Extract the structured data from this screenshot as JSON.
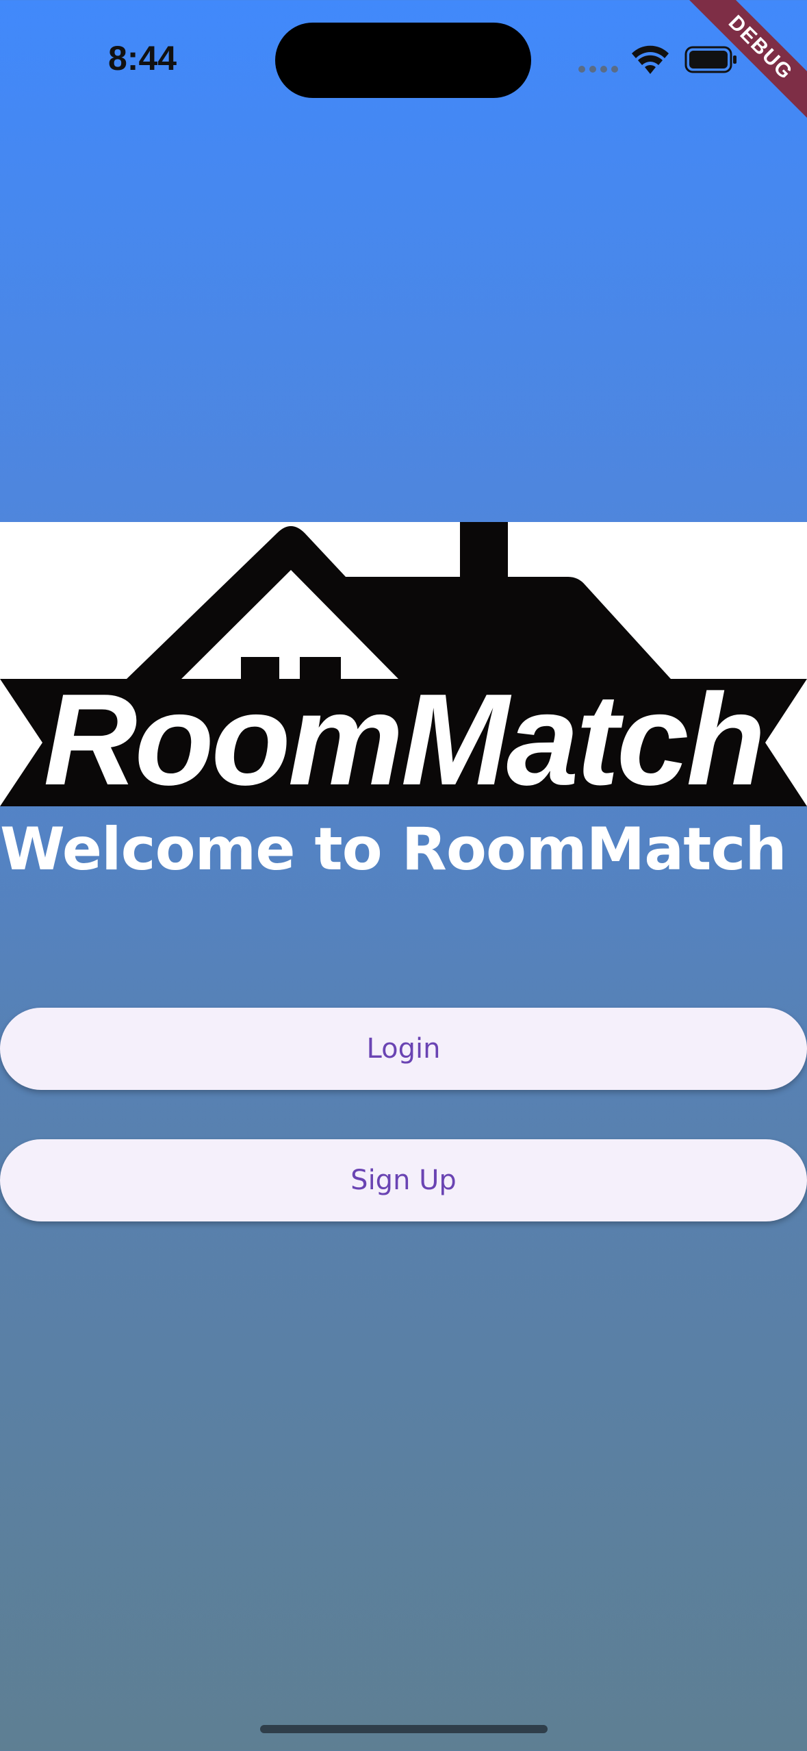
{
  "status_bar": {
    "time": "8:44",
    "icons": [
      "cellular-dots-icon",
      "wifi-icon",
      "battery-icon"
    ]
  },
  "debug_banner": "DEBUG",
  "logo": {
    "text": "RoomMatch",
    "icon": "house-roof-logo"
  },
  "welcome_title": "Welcome to RoomMatch",
  "buttons": {
    "login_label": "Login",
    "signup_label": "Sign Up"
  },
  "colors": {
    "gradient_top": "#4189fb",
    "gradient_bottom": "#5e7f93",
    "button_bg": "#f5f0fb",
    "button_text": "#6a44b3",
    "debug_banner": "#7e2e46"
  }
}
